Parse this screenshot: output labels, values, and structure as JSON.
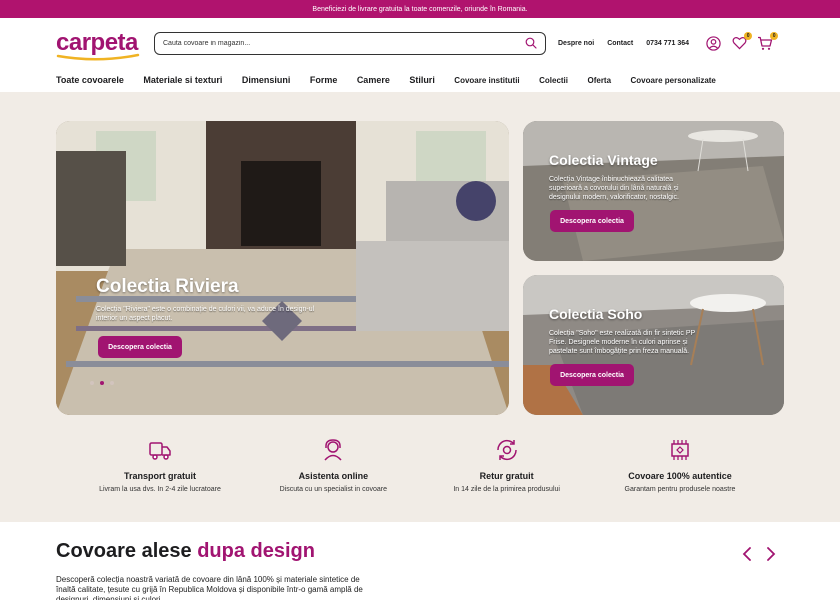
{
  "topbar": {
    "text": "Beneficiezi de livrare gratuita la toate comenzile, oriunde în Romania."
  },
  "header": {
    "logo": "carpeta",
    "search_placeholder": "Cauta covoare in magazin...",
    "links": [
      "Despre noi",
      "Contact",
      "0734 771 364"
    ],
    "wishlist_count": "0",
    "cart_count": "0"
  },
  "nav": [
    "Toate covoarele",
    "Materiale si texturi",
    "Dimensiuni",
    "Forme",
    "Camere",
    "Stiluri",
    "Covoare institutii",
    "Colectii",
    "Oferta",
    "Covoare personalizate"
  ],
  "hero": {
    "main": {
      "title": "Colectia Riviera",
      "desc": "Colecția \"Riviera\" este o combinație de culori vii, va aduce în design-ul interior un aspect placut.",
      "cta": "Descopera colectia"
    },
    "side1": {
      "title": "Colectia Vintage",
      "desc": "Colecția Vintage înbinuchiează calitatea superioară a covorului din lână naturală și designului modern, valorificator, nostalgic.",
      "cta": "Descopera colectia"
    },
    "side2": {
      "title": "Colectia Soho",
      "desc": "Colecția \"Soho\" este realizată din fir sintetic PP Frise. Designele moderne în culori aprinse și pastelate sunt îmbogățite prin freza manuală.",
      "cta": "Descopera colectia"
    },
    "active_slide": 2,
    "slide_count": 3
  },
  "features": [
    {
      "icon": "truck-icon",
      "title": "Transport gratuit",
      "sub": "Livram la usa dvs. In 2-4 zile lucratoare"
    },
    {
      "icon": "support-agent-icon",
      "title": "Asistenta online",
      "sub": "Discuta cu un specialist in covoare"
    },
    {
      "icon": "return-icon",
      "title": "Retur gratuit",
      "sub": "In 14 zile de la primirea produsului"
    },
    {
      "icon": "rug-fringe-icon",
      "title": "Covoare 100% autentice",
      "sub": "Garantam pentru produsele noastre"
    }
  ],
  "section": {
    "title_plain": "Covoare alese ",
    "title_accent": "dupa design",
    "text": "Descoperă colecția noastră variată de covoare din lână 100% și materiale sintetice de înaltă calitate, țesute cu grijă în Republica Moldova și disponibile într-o gamă amplă de designuri, dimensiuni și culori."
  },
  "colors": {
    "brand": "#a11471",
    "topbar": "#b0136e",
    "badge": "#f0b323",
    "hero_bg": "#f1ece6"
  }
}
